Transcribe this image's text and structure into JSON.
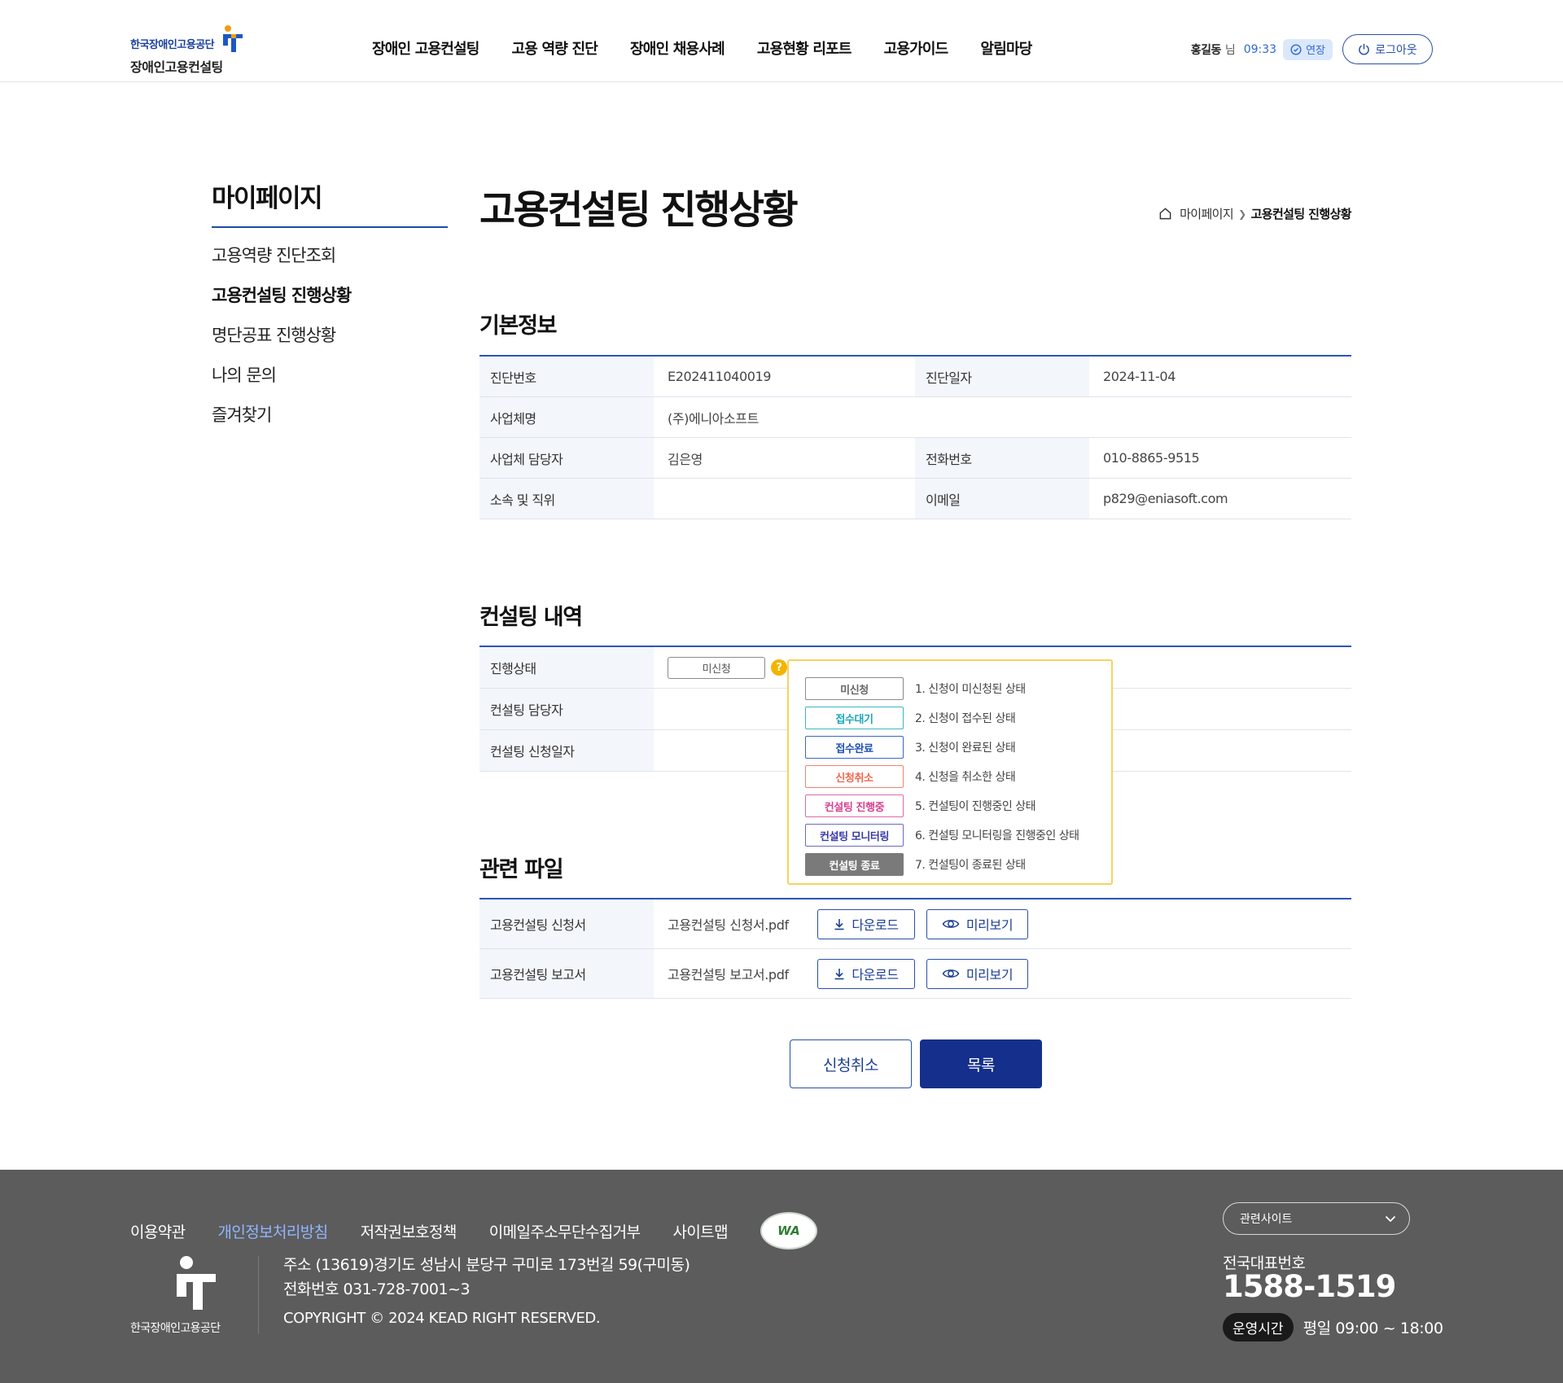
{
  "header": {
    "org_name": "한국장애인고용공단",
    "service_name": "장애인고용컨설팅",
    "nav": [
      "장애인 고용컨설팅",
      "고용 역량 진단",
      "장애인 채용사례",
      "고용현황 리포트",
      "고용가이드",
      "알림마당"
    ],
    "user_name": "홍길동",
    "user_suffix": "님",
    "session_time": "09:33",
    "extend_label": "연장",
    "logout_label": "로그아웃"
  },
  "sidebar": {
    "title": "마이페이지",
    "items": [
      "고용역량 진단조회",
      "고용컨설팅 진행상황",
      "명단공표 진행상황",
      "나의 문의",
      "즐겨찾기"
    ],
    "active_index": 1
  },
  "page": {
    "title": "고용컨설팅 진행상황",
    "breadcrumb": [
      "마이페이지",
      "고용컨설팅 진행상황"
    ]
  },
  "basic_info": {
    "section_title": "기본정보",
    "diag_no_label": "진단번호",
    "diag_no": "E202411040019",
    "diag_date_label": "진단일자",
    "diag_date": "2024-11-04",
    "company_label": "사업체명",
    "company": "(주)에니아소프트",
    "manager_label": "사업체 담당자",
    "manager": "김은영",
    "phone_label": "전화번호",
    "phone": "010-8865-9515",
    "dept_label": "소속 및 직위",
    "dept": "",
    "email_label": "이메일",
    "email": "p829@eniasoft.com"
  },
  "consulting": {
    "section_title": "컨설팅 내역",
    "status_label": "진행상태",
    "status_value": "미신청",
    "help_symbol": "?",
    "consultant_label": "컨설팅 담당자",
    "consultant": "",
    "apply_date_label": "컨설팅 신청일자",
    "apply_date": ""
  },
  "status_legend": [
    {
      "badge": "미신청",
      "desc": "1. 신청이 미신청된 상태",
      "color": "#666666",
      "border": "#8a8a8a",
      "bg": "#ffffff"
    },
    {
      "badge": "접수대기",
      "desc": "2. 신청이 접수된 상태",
      "color": "#1aa6b7",
      "border": "#3cb6c4",
      "bg": "#ffffff"
    },
    {
      "badge": "접수완료",
      "desc": "3. 신청이 완료된 상태",
      "color": "#1d4fb8",
      "border": "#3a67c6",
      "bg": "#ffffff"
    },
    {
      "badge": "신청취소",
      "desc": "4. 신청을 취소한 상태",
      "color": "#f0684a",
      "border": "#f0846d",
      "bg": "#ffffff"
    },
    {
      "badge": "컨설팅 진행중",
      "desc": "5. 컨설팅이 진행중인 상태",
      "color": "#d8408e",
      "border": "#e06aa7",
      "bg": "#ffffff"
    },
    {
      "badge": "컨설팅 모니터링",
      "desc": "6. 컨설팅 모니터링을 진행중인 상태",
      "color": "#3a3aa8",
      "border": "#6a6ac4",
      "bg": "#ffffff"
    },
    {
      "badge": "컨설팅 종료",
      "desc": "7. 컨설팅이 종료된 상태",
      "color": "#ffffff",
      "border": "#7a7a7a",
      "bg": "#7a7a7a"
    }
  ],
  "files": {
    "section_title": "관련 파일",
    "download_label": "다운로드",
    "preview_label": "미리보기",
    "rows": [
      {
        "label": "고용컨설팅 신청서",
        "file": "고용컨설팅 신청서.pdf"
      },
      {
        "label": "고용컨설팅 보고서",
        "file": "고용컨설팅 보고서.pdf"
      }
    ]
  },
  "actions": {
    "cancel_label": "신청취소",
    "list_label": "목록"
  },
  "footer": {
    "links": [
      "이용약관",
      "개인정보처리방침",
      "저작권보호정책",
      "이메일주소무단수집거부",
      "사이트맵"
    ],
    "highlight_index": 1,
    "wa_text": "WA",
    "org_name": "한국장애인고용공단",
    "address": "주소 (13619)경기도 성남시 분당구 구미로 173번길 59(구미동)",
    "phone": "전화번호 031-728-7001~3",
    "copyright": "COPYRIGHT © 2024 KEAD RIGHT RESERVED.",
    "related_sites_label": "관련사이트",
    "tel_label": "전국대표번호",
    "tel": "1588-1519",
    "hours_badge": "운영시간",
    "hours": "평일 09:00 ~ 18:00"
  },
  "colors": {
    "primary": "#142f8c",
    "accent_blue": "#2b55b8",
    "footer_bg": "#5c5c5c",
    "help_yellow": "#f4b400"
  }
}
